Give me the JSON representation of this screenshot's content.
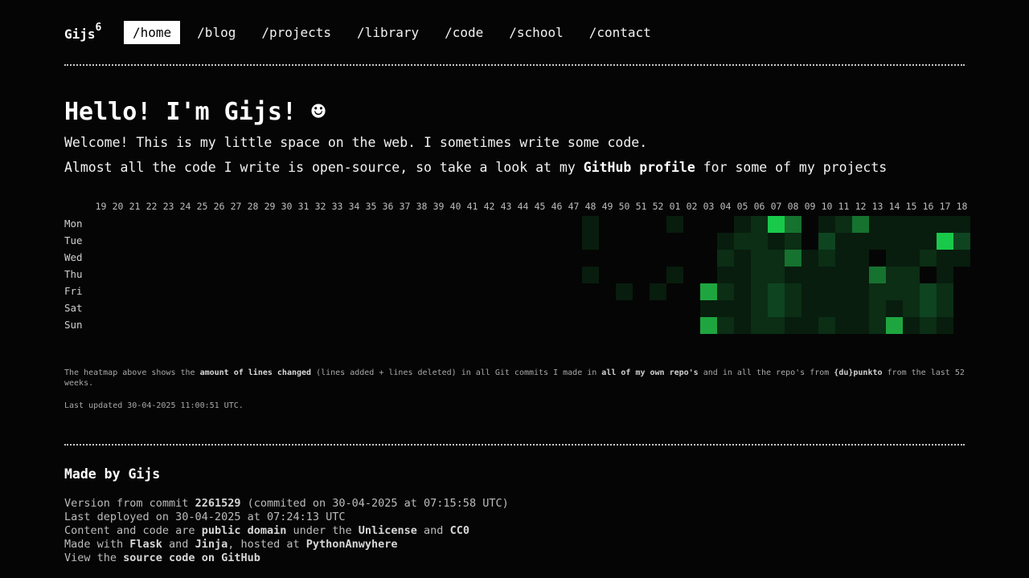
{
  "header": {
    "logo": {
      "text": "Gijs",
      "sup": "6"
    },
    "nav": [
      {
        "label": "/home",
        "active": true
      },
      {
        "label": "/blog"
      },
      {
        "label": "/projects"
      },
      {
        "label": "/library"
      },
      {
        "label": "/code"
      },
      {
        "label": "/school"
      },
      {
        "label": "/contact"
      }
    ]
  },
  "hero": {
    "title": "Hello! I'm Gijs! ☻",
    "line1": "Welcome! This is my little space on the web. I sometimes write some code.",
    "line2_before": "Almost all the code I write is open-source, so take a look at my ",
    "line2_link": "GitHub profile",
    "line2_after": " for some of my projects"
  },
  "heatmap": {
    "weeks": [
      "19",
      "20",
      "21",
      "22",
      "23",
      "24",
      "25",
      "26",
      "27",
      "28",
      "29",
      "30",
      "31",
      "32",
      "33",
      "34",
      "35",
      "36",
      "37",
      "38",
      "39",
      "40",
      "41",
      "42",
      "43",
      "44",
      "45",
      "46",
      "47",
      "48",
      "49",
      "50",
      "51",
      "52",
      "01",
      "02",
      "03",
      "04",
      "05",
      "06",
      "07",
      "08",
      "09",
      "10",
      "11",
      "12",
      "13",
      "14",
      "15",
      "16",
      "17",
      "18"
    ],
    "days": [
      "Mon",
      "Tue",
      "Wed",
      "Thu",
      "Fri",
      "Sat",
      "Sun"
    ],
    "scale_colors": [
      "#050505",
      "#081d0e",
      "#0b2e15",
      "#0f4421",
      "#16722f",
      "#1fa540",
      "#19c94a"
    ],
    "levels": [
      [
        0,
        0,
        0,
        0,
        0,
        0,
        0,
        0,
        0,
        0,
        0,
        0,
        0,
        0,
        0,
        0,
        0,
        0,
        0,
        0,
        0,
        0,
        0,
        0,
        0,
        0,
        0,
        0,
        0,
        1,
        0,
        0,
        0,
        0,
        1,
        0,
        0,
        0,
        1,
        2,
        6,
        4,
        0,
        1,
        2,
        4,
        1,
        1,
        1,
        1,
        1,
        1
      ],
      [
        0,
        0,
        0,
        0,
        0,
        0,
        0,
        0,
        0,
        0,
        0,
        0,
        0,
        0,
        0,
        0,
        0,
        0,
        0,
        0,
        0,
        0,
        0,
        0,
        0,
        0,
        0,
        0,
        0,
        1,
        0,
        0,
        0,
        0,
        0,
        0,
        0,
        1,
        2,
        2,
        1,
        2,
        0,
        3,
        1,
        1,
        1,
        1,
        1,
        1,
        6,
        3
      ],
      [
        0,
        0,
        0,
        0,
        0,
        0,
        0,
        0,
        0,
        0,
        0,
        0,
        0,
        0,
        0,
        0,
        0,
        0,
        0,
        0,
        0,
        0,
        0,
        0,
        0,
        0,
        0,
        0,
        0,
        0,
        0,
        0,
        0,
        0,
        0,
        0,
        0,
        2,
        1,
        2,
        2,
        4,
        1,
        2,
        1,
        1,
        0,
        1,
        1,
        2,
        1,
        1
      ],
      [
        0,
        0,
        0,
        0,
        0,
        0,
        0,
        0,
        0,
        0,
        0,
        0,
        0,
        0,
        0,
        0,
        0,
        0,
        0,
        0,
        0,
        0,
        0,
        0,
        0,
        0,
        0,
        0,
        0,
        1,
        0,
        0,
        0,
        0,
        1,
        0,
        0,
        1,
        1,
        2,
        2,
        1,
        1,
        1,
        1,
        1,
        4,
        2,
        2,
        0,
        1,
        0
      ],
      [
        0,
        0,
        0,
        0,
        0,
        0,
        0,
        0,
        0,
        0,
        0,
        0,
        0,
        0,
        0,
        0,
        0,
        0,
        0,
        0,
        0,
        0,
        0,
        0,
        0,
        0,
        0,
        0,
        0,
        0,
        0,
        1,
        0,
        1,
        0,
        0,
        5,
        2,
        1,
        2,
        3,
        2,
        1,
        1,
        1,
        1,
        2,
        2,
        2,
        3,
        2,
        0
      ],
      [
        0,
        0,
        0,
        0,
        0,
        0,
        0,
        0,
        0,
        0,
        0,
        0,
        0,
        0,
        0,
        0,
        0,
        0,
        0,
        0,
        0,
        0,
        0,
        0,
        0,
        0,
        0,
        0,
        0,
        0,
        0,
        0,
        0,
        0,
        0,
        0,
        1,
        1,
        1,
        2,
        3,
        2,
        1,
        1,
        1,
        1,
        2,
        1,
        2,
        3,
        2,
        0
      ],
      [
        0,
        0,
        0,
        0,
        0,
        0,
        0,
        0,
        0,
        0,
        0,
        0,
        0,
        0,
        0,
        0,
        0,
        0,
        0,
        0,
        0,
        0,
        0,
        0,
        0,
        0,
        0,
        0,
        0,
        0,
        0,
        0,
        0,
        0,
        0,
        0,
        5,
        2,
        1,
        2,
        2,
        1,
        1,
        2,
        1,
        1,
        2,
        5,
        1,
        2,
        1,
        0
      ]
    ],
    "note": {
      "p1": "The heatmap above shows the ",
      "b1": "amount of lines changed",
      "p2": " (lines added + lines deleted) in all Git commits I made in ",
      "a1": "all of my own repo's",
      "p3": " and in all the repo's from ",
      "a2": "{du}punkto",
      "p4": " from the last 52 weeks."
    },
    "updated": "Last updated 30-04-2025 11:00:51 UTC."
  },
  "footer": {
    "title": "Made by Gijs",
    "version_pre": "Version from commit ",
    "commit": "2261529",
    "version_post": " (commited on 30-04-2025 at 07:15:58 UTC)",
    "deployed": "Last deployed on 30-04-2025 at 07:24:13 UTC",
    "content_pre": "Content and code are ",
    "content_bold": "public domain",
    "content_mid": " under the ",
    "license1": "Unlicense",
    "content_and": " and ",
    "license2": "CC0",
    "made_pre": "Made with ",
    "flask": "Flask",
    "made_and": " and ",
    "jinja": "Jinja",
    "made_mid": ", hosted at ",
    "host": "PythonAnwyhere",
    "view_pre": "View the ",
    "source": "source code on GitHub"
  }
}
